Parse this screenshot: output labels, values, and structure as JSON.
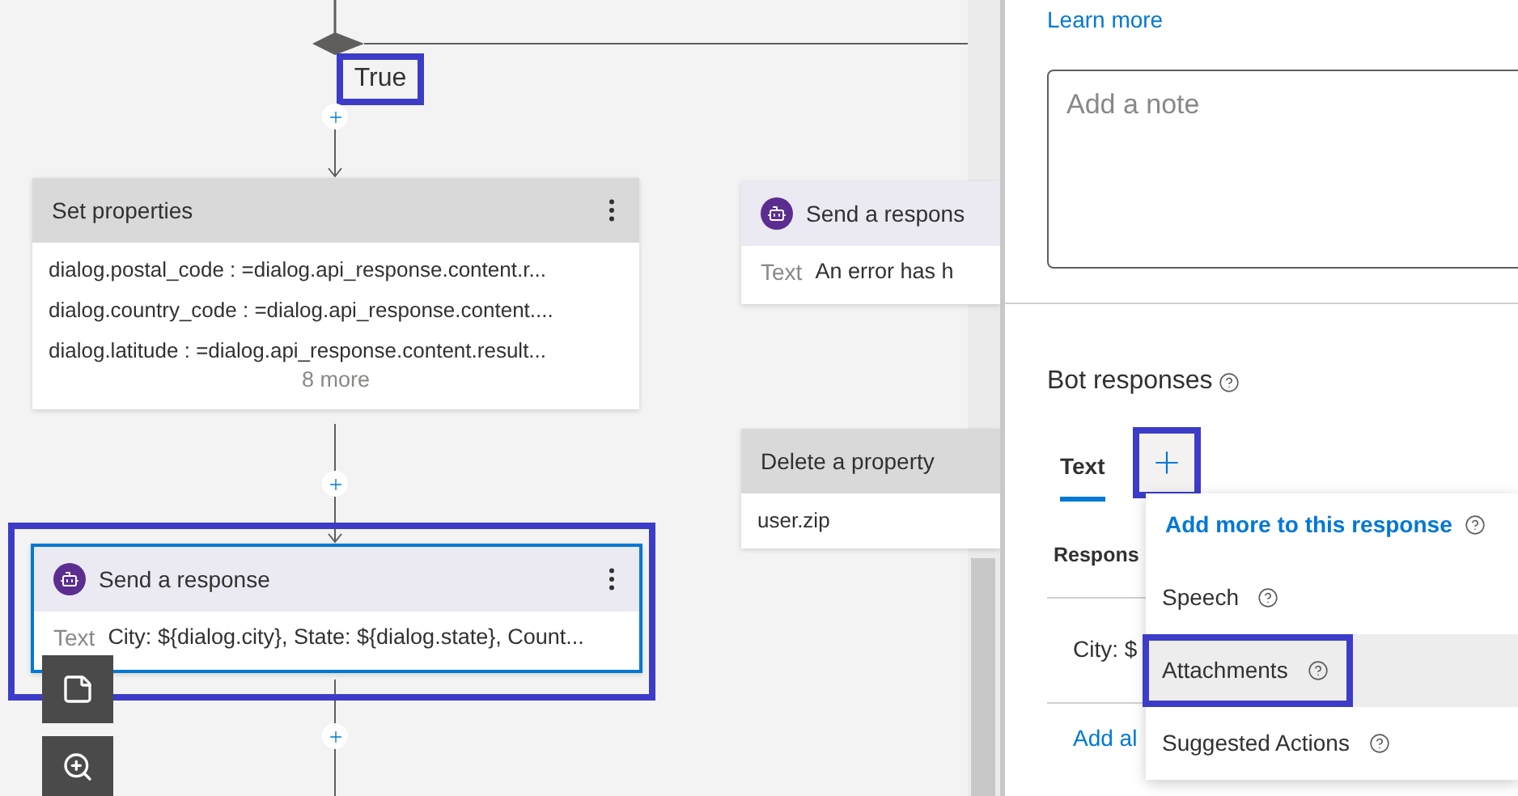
{
  "canvas": {
    "branch_label": {
      "text": "True",
      "highlighted": true
    },
    "nodes": [
      {
        "kind": "properties",
        "title": "Set properties",
        "lines": [
          "dialog.postal_code : =dialog.api_response.content.r...",
          "dialog.country_code : =dialog.api_response.content....",
          "dialog.latitude : =dialog.api_response.content.result..."
        ],
        "more": "8 more",
        "selected": false,
        "highlighted": false
      },
      {
        "kind": "response",
        "title": "Send a response",
        "label": "Text",
        "text": "City: ${dialog.city}, State: ${dialog.state}, Count...",
        "selected": true,
        "highlighted": true
      },
      {
        "kind": "response",
        "title": "Send a respons",
        "label": "Text",
        "text": "An error has h",
        "selected": false,
        "highlighted": false
      },
      {
        "kind": "properties",
        "title": "Delete a property",
        "lines": [
          "user.zip"
        ],
        "selected": false,
        "highlighted": false
      }
    ]
  },
  "panel": {
    "learn_more": "Learn more",
    "note": {
      "placeholder": "Add a note"
    },
    "section_title": "Bot responses",
    "tabs": [
      {
        "label": "Text",
        "selected": true
      }
    ],
    "add_button": {
      "highlighted": true
    },
    "response_header": "Respons",
    "responses": [
      "City: $"
    ],
    "add_alternative": "Add al",
    "menu": {
      "title": "Add more to this response",
      "items": [
        {
          "label": "Speech",
          "hovered": false,
          "highlighted": false
        },
        {
          "label": "Attachments",
          "hovered": true,
          "highlighted": true
        },
        {
          "label": "Suggested Actions",
          "hovered": false,
          "highlighted": false
        }
      ]
    }
  }
}
